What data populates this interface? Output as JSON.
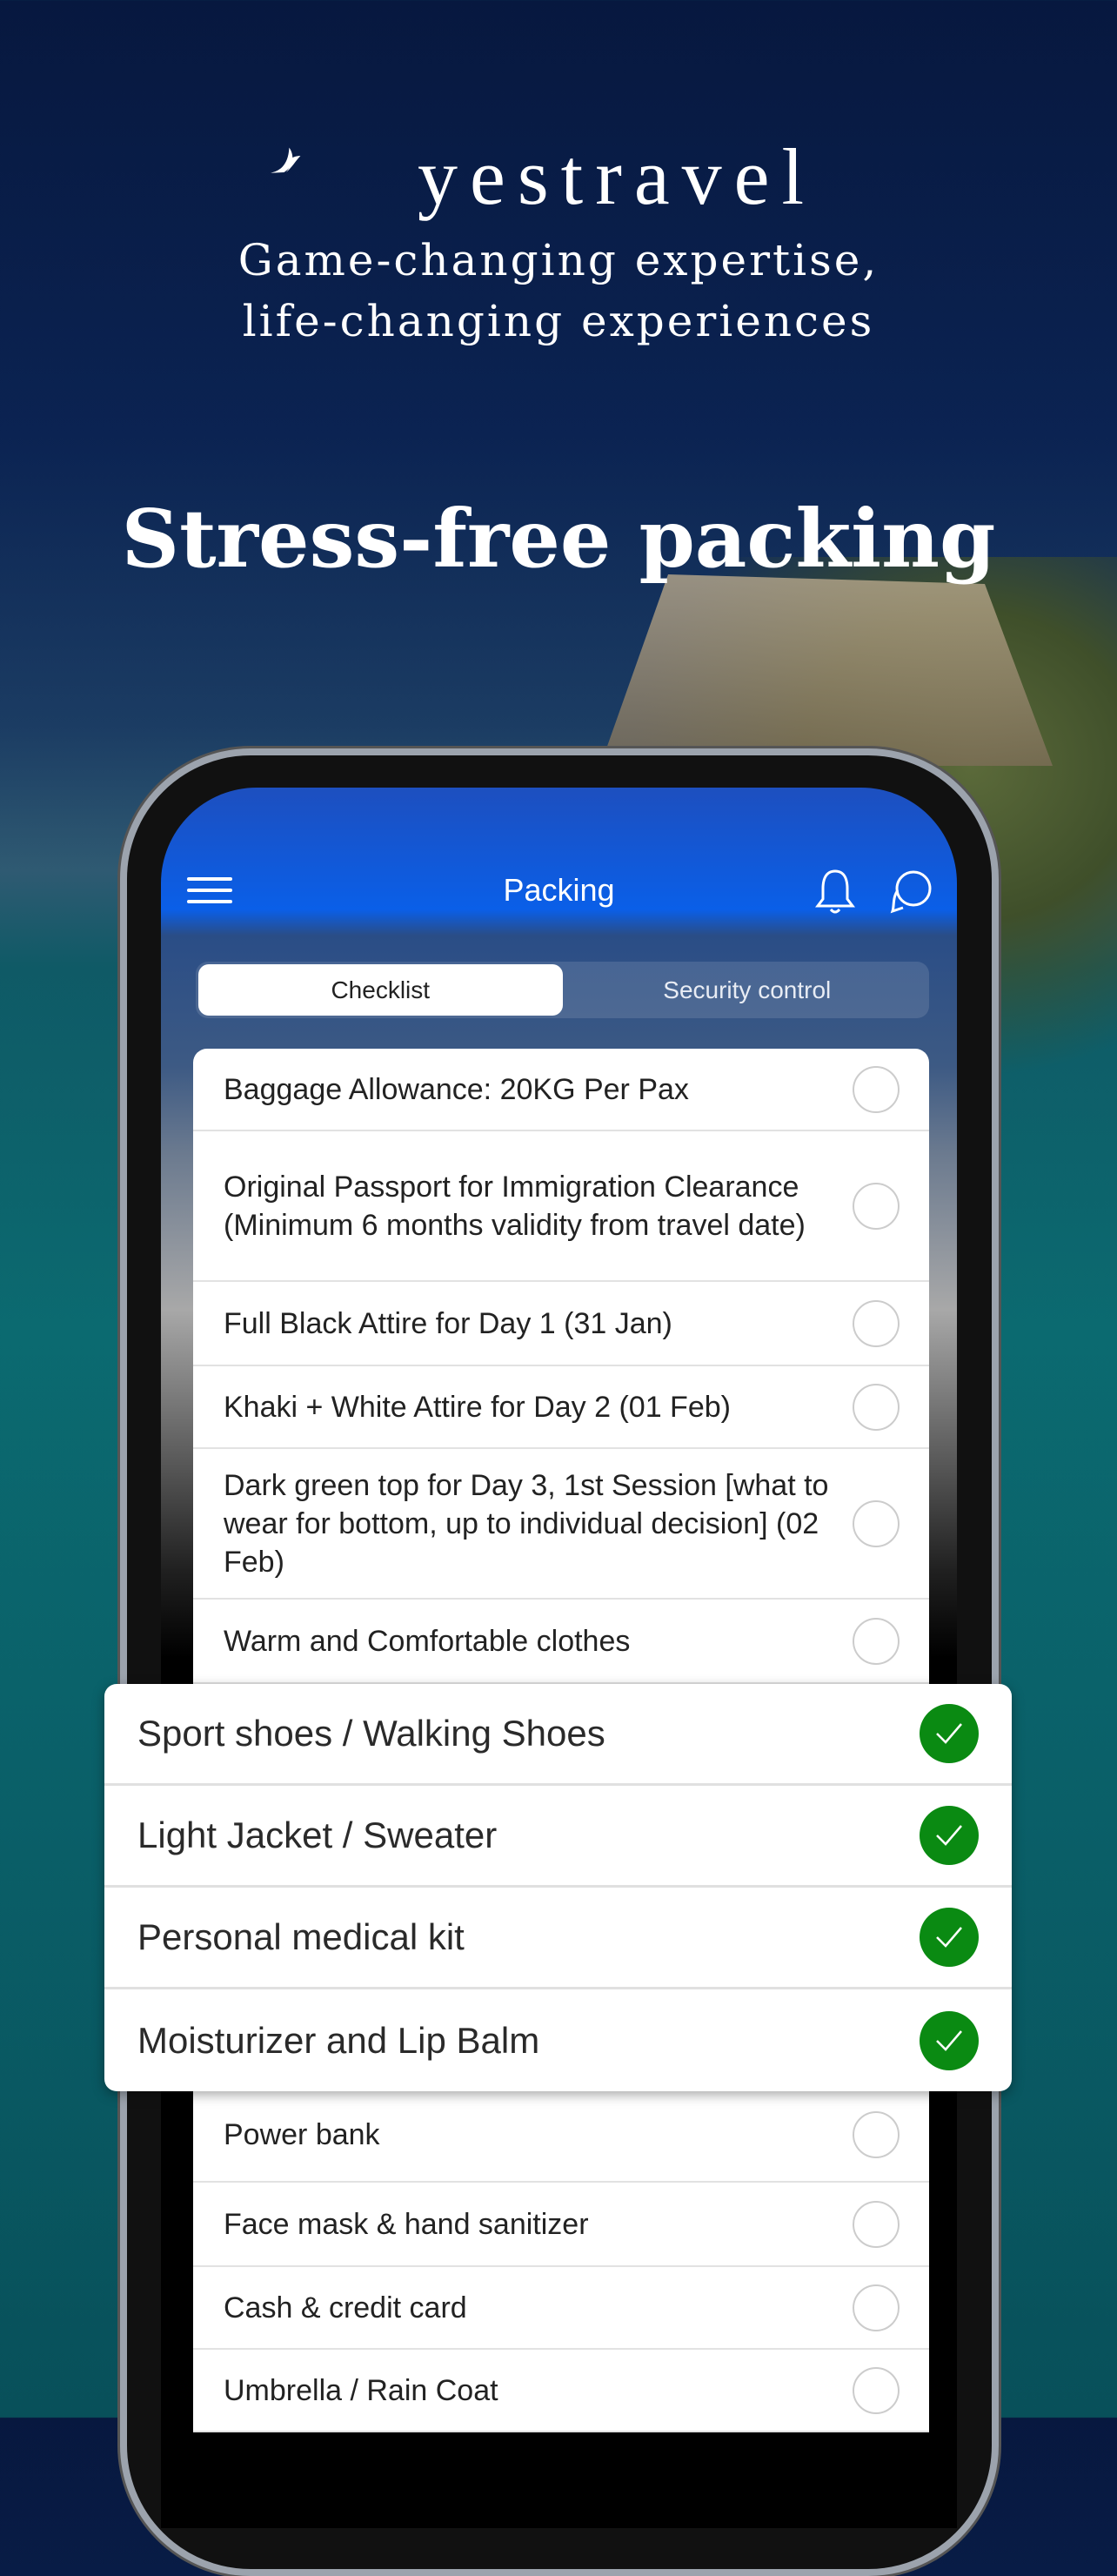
{
  "brand": {
    "name": "yestravel",
    "tagline_line1": "Game-changing expertise,",
    "tagline_line2": "life-changing experiences"
  },
  "headline": "Stress-free packing",
  "app": {
    "title": "Packing",
    "tabs": [
      {
        "label": "Checklist",
        "selected": true
      },
      {
        "label": "Security control",
        "selected": false
      }
    ],
    "items_top": [
      {
        "label": "Baggage Allowance: 20KG Per Pax",
        "checked": false
      },
      {
        "label": "Original Passport for Immigration Clearance (Minimum 6 months validity from travel date)",
        "checked": false
      },
      {
        "label": "Full Black Attire for Day 1 (31 Jan)",
        "checked": false
      },
      {
        "label": "Khaki + White Attire for Day 2 (01 Feb)",
        "checked": false
      },
      {
        "label": "Dark green top for Day 3, 1st Session [what to wear for bottom, up to individual decision] (02 Feb)",
        "checked": false
      },
      {
        "label": "Warm and Comfortable clothes",
        "checked": false
      }
    ],
    "items_checked": [
      {
        "label": "Sport shoes / Walking Shoes",
        "checked": true
      },
      {
        "label": "Light Jacket / Sweater",
        "checked": true
      },
      {
        "label": "Personal medical kit",
        "checked": true
      },
      {
        "label": "Moisturizer and Lip Balm",
        "checked": true
      }
    ],
    "items_bottom": [
      {
        "label": "Power bank",
        "checked": false
      },
      {
        "label": "Face mask & hand sanitizer",
        "checked": false
      },
      {
        "label": "Cash & credit card",
        "checked": false
      },
      {
        "label": "Umbrella / Rain Coat",
        "checked": false
      }
    ]
  },
  "colors": {
    "header_blue": "#0a5fe8",
    "check_green": "#0a8a12"
  }
}
